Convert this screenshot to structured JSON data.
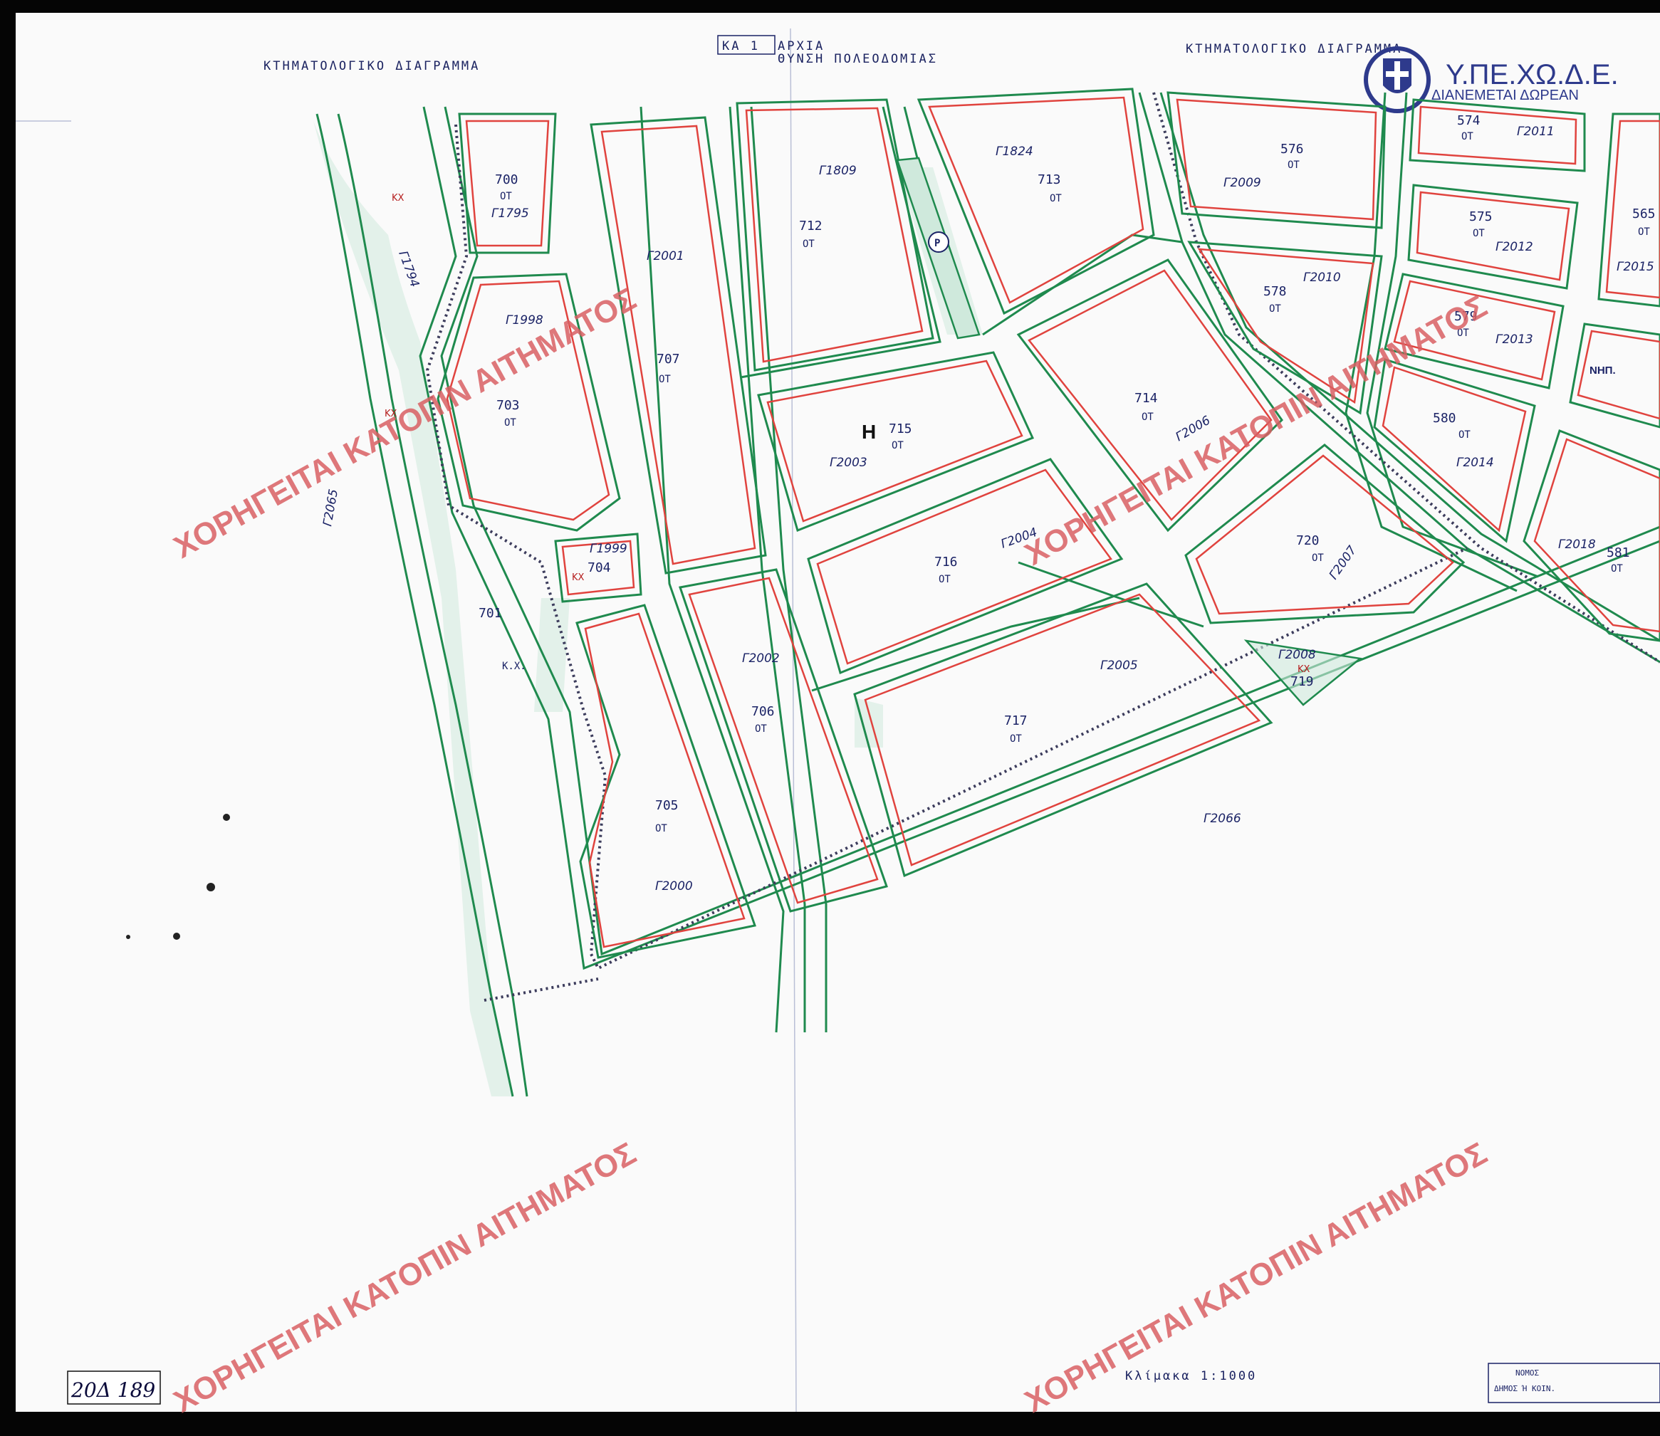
{
  "header": {
    "title_left": "ΚΤΗΜΑΤΟΛΟΓΙΚΟ ΔΙΑΓΡΑΜΜΑ",
    "title_right": "ΚΤΗΜΑΤΟΛΟΓΙΚΟ ΔΙΑΓΡΑΜΜΑ",
    "center_top": "ΑΡΧΙΑ",
    "center_sub": "ΘΥΝΣΗ ΠΟΛΕΟΔΟΜΙΑΣ",
    "stamp": "ΚΑ 1"
  },
  "logo": {
    "name": "Υ.ΠΕ.ΧΩ.Δ.Ε.",
    "tagline": "ΔΙΑΝΕΜΕΤΑΙ ΔΩΡΕΑΝ",
    "icon": "greek-coat-of-arms-icon"
  },
  "watermark": "ΧΟΡΗΓΕΙΤΑΙ ΚΑΤΟΠΙΝ ΑΙΤΗΜΑΤΟΣ",
  "sector_letter": "Η",
  "abbr": {
    "ot": "ΟΤ",
    "kx": "ΚΧ",
    "kx_dot": "Κ.Χ.",
    "nip": "ΝΗΠ."
  },
  "blocks": {
    "b700": "700",
    "b701": "701",
    "b703": "703",
    "b704": "704",
    "b705": "705",
    "b706": "706",
    "b707": "707",
    "b712": "712",
    "b713": "713",
    "b714": "714",
    "b715": "715",
    "b716": "716",
    "b717": "717",
    "b719": "719",
    "b720": "720",
    "b565": "565",
    "b574": "574",
    "b575": "575",
    "b576": "576",
    "b578": "578",
    "b579": "579",
    "b580": "580",
    "b581": "581"
  },
  "codes": {
    "g1795": "Γ1795",
    "g1794": "Γ1794",
    "g1998": "Γ1998",
    "g1999": "Γ1999",
    "g2000": "Γ2000",
    "g2001": "Γ2001",
    "g2002": "Γ2002",
    "g2003": "Γ2003",
    "g2004": "Γ2004",
    "g2005": "Γ2005",
    "g2006": "Γ2006",
    "g2007": "Γ2007",
    "g2008": "Γ2008",
    "g2009": "Γ2009",
    "g2010": "Γ2010",
    "g2011": "Γ2011",
    "g2012": "Γ2012",
    "g2013": "Γ2013",
    "g2014": "Γ2014",
    "g2015": "Γ2015",
    "g2018": "Γ2018",
    "g1809": "Γ1809",
    "g1824": "Γ1824",
    "g2065": "Γ2065",
    "g2066": "Γ2066"
  },
  "parking": "P",
  "footer": {
    "scale": "Κλίμακα 1:1000",
    "sheet_code": "20Δ 189",
    "nomos": "ΝΟΜΟΣ",
    "dimos": "ΔΗΜΟΣ Ή ΚΟΙΝ."
  },
  "colors": {
    "boundary_red": "#e0433e",
    "road_green": "#1f8a4e",
    "road_fill": "#cfe9dc",
    "watermark": "#d85f63",
    "ink_blue": "#1b2366"
  }
}
